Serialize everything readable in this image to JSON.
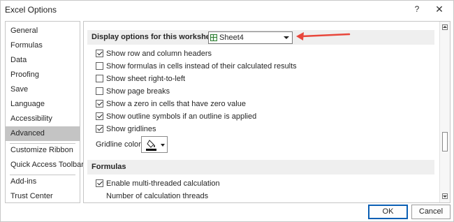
{
  "window": {
    "title": "Excel Options",
    "help_label": "?",
    "close_label": "✕"
  },
  "nav": {
    "items": [
      {
        "label": "General"
      },
      {
        "label": "Formulas"
      },
      {
        "label": "Data"
      },
      {
        "label": "Proofing"
      },
      {
        "label": "Save"
      },
      {
        "label": "Language"
      },
      {
        "label": "Accessibility"
      },
      {
        "label": "Advanced",
        "selected": true
      },
      {
        "label": "Customize Ribbon"
      },
      {
        "label": "Quick Access Toolbar"
      },
      {
        "label": "Add-ins"
      },
      {
        "label": "Trust Center"
      }
    ]
  },
  "worksheet_section": {
    "heading": "Display options for this worksheet:",
    "sheet_selected": "Sheet4",
    "options": [
      {
        "label": "Show row and column headers",
        "checked": true
      },
      {
        "label": "Show formulas in cells instead of their calculated results",
        "checked": false
      },
      {
        "label": "Show sheet right-to-left",
        "checked": false
      },
      {
        "label": "Show page breaks",
        "checked": false
      },
      {
        "label": "Show a zero in cells that have zero value",
        "checked": true
      },
      {
        "label": "Show outline symbols if an outline is applied",
        "checked": true
      },
      {
        "label": "Show gridlines",
        "checked": true
      }
    ],
    "gridline_color_label": "Gridline color",
    "gridline_color": "#000000"
  },
  "formulas_section": {
    "heading": "Formulas",
    "multithread_label": "Enable multi-threaded calculation",
    "multithread_checked": true,
    "threads_label": "Number of calculation threads"
  },
  "buttons": {
    "ok": "OK",
    "cancel": "Cancel"
  },
  "colors": {
    "annotation_arrow": "#e8473c",
    "ok_border": "#0a5fb4",
    "selected_nav": "#c4c4c4"
  }
}
